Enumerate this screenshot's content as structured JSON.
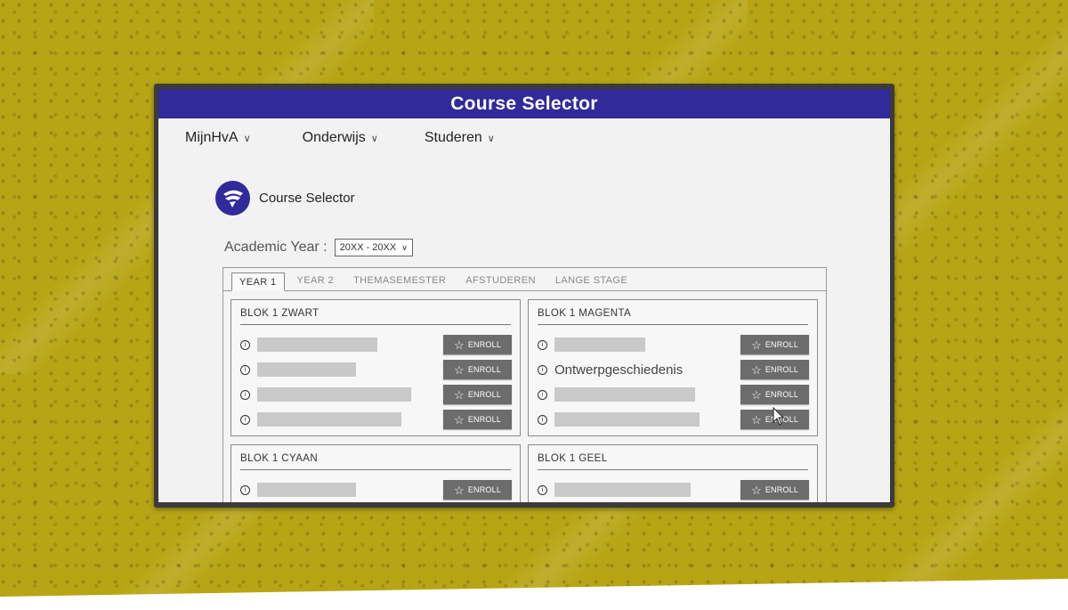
{
  "window": {
    "title": "Course Selector"
  },
  "nav": [
    {
      "label": "MijnHvA"
    },
    {
      "label": "Onderwijs"
    },
    {
      "label": "Studeren"
    }
  ],
  "brand": {
    "title": "Course Selector"
  },
  "academic_year": {
    "label": "Academic Year :",
    "value": "20XX - 20XX"
  },
  "tabs": [
    {
      "label": "YEAR 1",
      "active": true
    },
    {
      "label": "YEAR 2"
    },
    {
      "label": "THEMASEMESTER"
    },
    {
      "label": "AFSTUDEREN"
    },
    {
      "label": "LANGE STAGE"
    }
  ],
  "enroll_label": "ENROLL",
  "info_glyph": "i",
  "bloks": [
    {
      "title": "BLOK 1 ZWART",
      "courses": [
        {
          "name": ""
        },
        {
          "name": ""
        },
        {
          "name": ""
        },
        {
          "name": ""
        }
      ]
    },
    {
      "title": "BLOK 1 MAGENTA",
      "courses": [
        {
          "name": ""
        },
        {
          "name": "Ontwerpgeschiedenis"
        },
        {
          "name": ""
        },
        {
          "name": ""
        }
      ]
    },
    {
      "title": "BLOK 1 CYAAN",
      "courses": [
        {
          "name": ""
        }
      ]
    },
    {
      "title": "BLOK 1 GEEL",
      "courses": [
        {
          "name": ""
        }
      ]
    }
  ],
  "colors": {
    "title_bar": "#302a9a",
    "background": "#b8a515",
    "enroll_button": "#6c6c6c",
    "placeholder_bar": "#c9c9c9"
  }
}
